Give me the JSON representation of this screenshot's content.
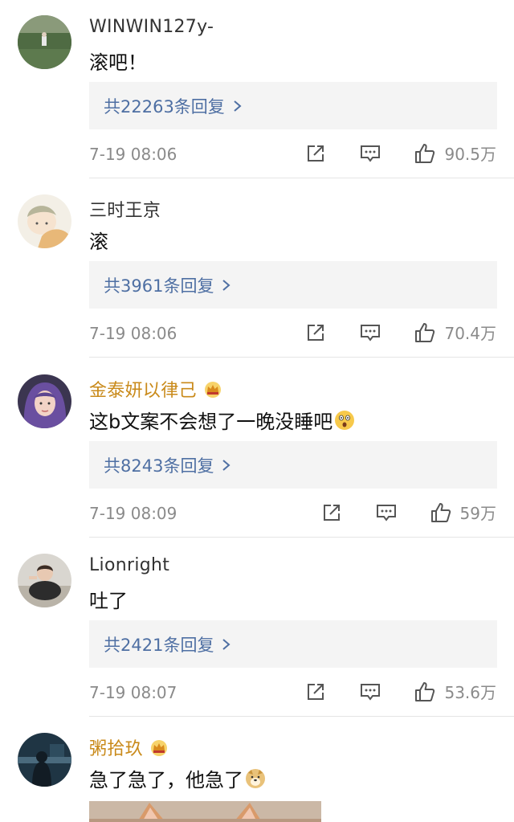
{
  "comments": [
    {
      "username": "WINWIN127y-",
      "name_color": "gray",
      "text": "滚吧！",
      "reply_link": "共22263条回复",
      "time": "7-19 08:06",
      "likes": "90.5万",
      "avatar": "landscape-avatar",
      "crown": false,
      "emoji": null
    },
    {
      "username": "三时王京",
      "name_color": "gray",
      "text": "滚",
      "reply_link": "共3961条回复",
      "time": "7-19 08:06",
      "likes": "70.4万",
      "avatar": "anime-avatar",
      "crown": false,
      "emoji": null
    },
    {
      "username": "金泰妍以律己",
      "name_color": "gold",
      "text": "这b文案不会想了一晚没睡吧",
      "reply_link": "共8243条回复",
      "time": "7-19 08:09",
      "likes": "59万",
      "avatar": "girl-avatar",
      "crown": true,
      "emoji": "astonished-emoji"
    },
    {
      "username": "Lionright",
      "name_color": "gray",
      "text": "吐了",
      "reply_link": "共2421条回复",
      "time": "7-19 08:07",
      "likes": "53.6万",
      "avatar": "person-avatar",
      "crown": false,
      "emoji": null
    },
    {
      "username": "粥拾玖",
      "name_color": "gold",
      "text": "急了急了，他急了",
      "avatar": "night-avatar",
      "crown": true,
      "emoji": "doge-emoji"
    }
  ],
  "colors": {
    "gold_name": "#c98a1a",
    "reply_link": "#4e6fa3",
    "meta_gray": "#8a8a8a",
    "reply_bg": "#f4f4f4"
  }
}
